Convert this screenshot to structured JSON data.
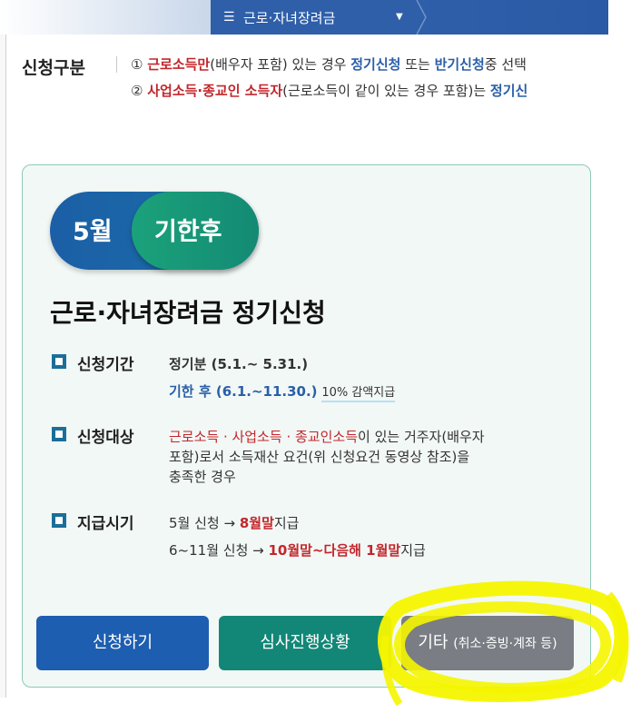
{
  "nav": {
    "menu_icon": "hamburger-icon",
    "current_label": "근로·자녀장려금",
    "caret_icon": "caret-down-icon"
  },
  "category": {
    "label": "신청구분",
    "line1": {
      "num": "①",
      "red": "근로소득만",
      "mid1": "(배우자 포함) 있는 경우 ",
      "blue1": "정기신청",
      "mid2": " 또는 ",
      "blue2": "반기신청",
      "tail": "중 선택"
    },
    "line2": {
      "num": "②",
      "red": "사업소득·종교인 소득자",
      "mid1": "(근로소득이 같이 있는 경우 포함)는 ",
      "blue1": "정기신"
    }
  },
  "card": {
    "pill_month": "5월",
    "pill_badge": "기한후",
    "title": "근로·자녀장려금 정기신청",
    "period": {
      "label": "신청기간",
      "line1": "정기분 (5.1.~ 5.31.)",
      "line2": "기한 후 (6.1.~11.30.)",
      "line2_note": "10% 감액지급"
    },
    "target": {
      "label": "신청대상",
      "red": "근로소득 · 사업소득 · 종교인소득",
      "rest1": "이 있는 거주자(배우자",
      "rest2": "포함)로서 소득재산 요건(위 신청요건 동영상 참조)을",
      "rest3": "충족한 경우"
    },
    "payment": {
      "label": "지급시기",
      "line1_pre": "5월 신청 → ",
      "line1_red": "8월말",
      "line1_post": "지급",
      "line2_pre": "6~11월 신청 → ",
      "line2_red": "10월말~다음해 1월말",
      "line2_post": "지급"
    }
  },
  "buttons": {
    "apply": "신청하기",
    "status": "심사진행상황",
    "etc_main": "기타",
    "etc_sub": "(취소·증빙·계좌 등)"
  },
  "colors": {
    "nav_blue": "#2f5fa9",
    "red_text": "#c3262b",
    "blue_text": "#2a5fa8",
    "apply_button": "#1d5eb0",
    "status_button": "#138777",
    "etc_button": "#7a7d84",
    "highlight_scribble": "#f5f500"
  }
}
